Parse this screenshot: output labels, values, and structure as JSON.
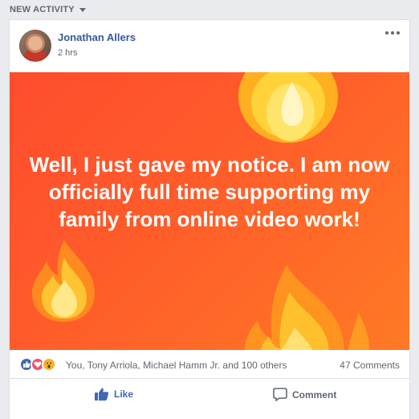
{
  "feed": {
    "section_label": "NEW ACTIVITY"
  },
  "post": {
    "author": "Jonathan Allers",
    "timestamp": "2 hrs",
    "body_text": "Well, I just gave my notice. I am now officially full time supporting my family from online video work!",
    "background_colors": [
      "#ff4d2e",
      "#ff7a25"
    ],
    "reactions": {
      "types": [
        "like",
        "love",
        "wow"
      ],
      "names_text": "You, Tony Arriola, Michael Hamm Jr. and 100 others",
      "comment_count_text": "47 Comments"
    },
    "actions": {
      "like_label": "Like",
      "comment_label": "Comment"
    }
  },
  "icons": {
    "more": "more-horizontal-icon",
    "like": "thumbs-up-icon",
    "comment": "speech-bubble-icon",
    "decorations": "fire-emoji"
  },
  "colors": {
    "brand_link": "#385898",
    "like_blue": "#4267b2",
    "love_red": "#f25268",
    "wow_yellow": "#f7b125"
  }
}
